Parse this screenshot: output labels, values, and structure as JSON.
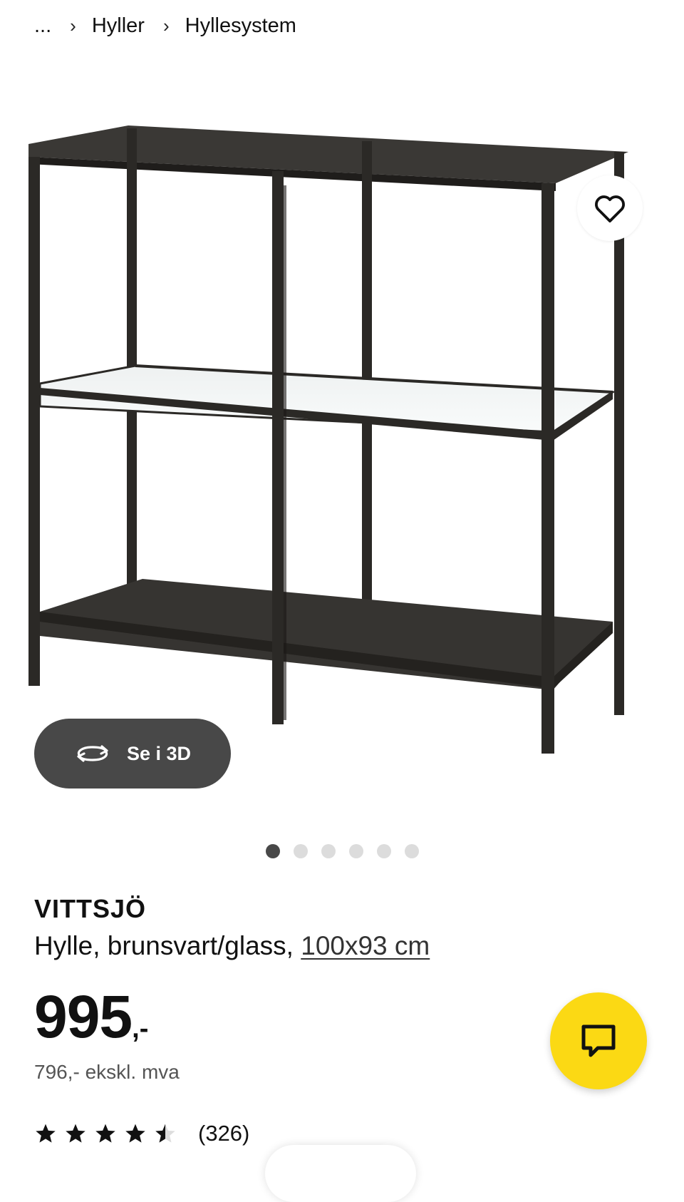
{
  "breadcrumb": {
    "ellipsis": "...",
    "items": [
      "Hyller",
      "Hyllesystem"
    ]
  },
  "gallery": {
    "view3d_label": "Se i 3D",
    "dots_total": 6,
    "active_dot": 1
  },
  "product": {
    "name": "VITTSJÖ",
    "description": "Hylle, brunsvart/glass, ",
    "measurement": "100x93 cm",
    "price": "995",
    "price_suffix": ",-",
    "price_ex_vat": "796,- ekskl. mva",
    "rating": 4.5,
    "review_count": "(326)"
  },
  "colors": {
    "accent_yellow": "#fbd914",
    "dark_button": "#484848",
    "frame": "#2b2926"
  },
  "icons": [
    "chevron-right-icon",
    "heart-icon",
    "rotate-3d-icon",
    "chat-icon",
    "star-icon"
  ]
}
